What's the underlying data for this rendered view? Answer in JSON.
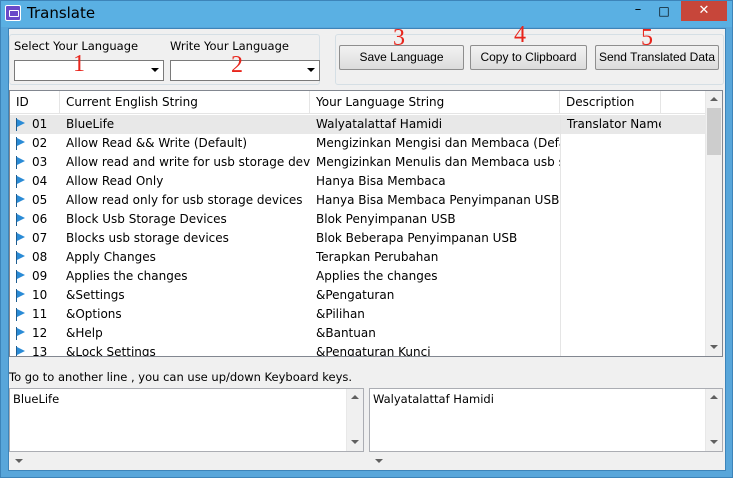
{
  "window": {
    "title": "Translate"
  },
  "language": {
    "select_label": "Select Your Language",
    "select_value": "",
    "write_label": "Write Your Language",
    "write_value": ""
  },
  "toolbar": {
    "save_label": "Save Language",
    "copy_label": "Copy to Clipboard",
    "send_label": "Send Translated Data"
  },
  "annotations": [
    "1",
    "2",
    "3",
    "4",
    "5"
  ],
  "grid": {
    "columns": [
      "ID",
      "Current English String",
      "Your Language String",
      "Description"
    ],
    "rows": [
      {
        "id": "01",
        "en": "BlueLife",
        "lang": "Walyatalattaf Hamidi",
        "desc": "Translator Name"
      },
      {
        "id": "02",
        "en": "Allow Read && Write (Default)",
        "lang": "Mengizinkan Mengisi dan Membaca (Defa...",
        "desc": ""
      },
      {
        "id": "03",
        "en": "Allow read and write for usb storage devices",
        "lang": "Mengizinkan Menulis dan Membaca usb st...",
        "desc": ""
      },
      {
        "id": "04",
        "en": "Allow Read Only",
        "lang": "Hanya Bisa Membaca",
        "desc": ""
      },
      {
        "id": "05",
        "en": "Allow read only for usb storage devices",
        "lang": "Hanya Bisa Membaca Penyimpanan USB",
        "desc": ""
      },
      {
        "id": "06",
        "en": "Block Usb Storage Devices",
        "lang": "Blok Penyimpanan USB",
        "desc": ""
      },
      {
        "id": "07",
        "en": "Blocks usb storage devices",
        "lang": "Blok Beberapa Penyimpanan USB",
        "desc": ""
      },
      {
        "id": "08",
        "en": "Apply Changes",
        "lang": "Terapkan Perubahan",
        "desc": ""
      },
      {
        "id": "09",
        "en": "Applies the changes",
        "lang": "Applies the changes",
        "desc": ""
      },
      {
        "id": "10",
        "en": "&Settings",
        "lang": "&Pengaturan",
        "desc": ""
      },
      {
        "id": "11",
        "en": "&Options",
        "lang": "&Pilihan",
        "desc": ""
      },
      {
        "id": "12",
        "en": "&Help",
        "lang": "&Bantuan",
        "desc": ""
      },
      {
        "id": "13",
        "en": "&Lock Settings",
        "lang": "&Pengaturan Kunci",
        "desc": ""
      }
    ]
  },
  "hint": "To go to another line , you can use up/down Keyboard keys.",
  "editors": {
    "english_text": "BlueLife",
    "language_text": "Walyatalattaf Hamidi"
  },
  "colors": {
    "accent": "#5ab0e3",
    "close": "#c7463a",
    "annotation": "#e8251c"
  }
}
